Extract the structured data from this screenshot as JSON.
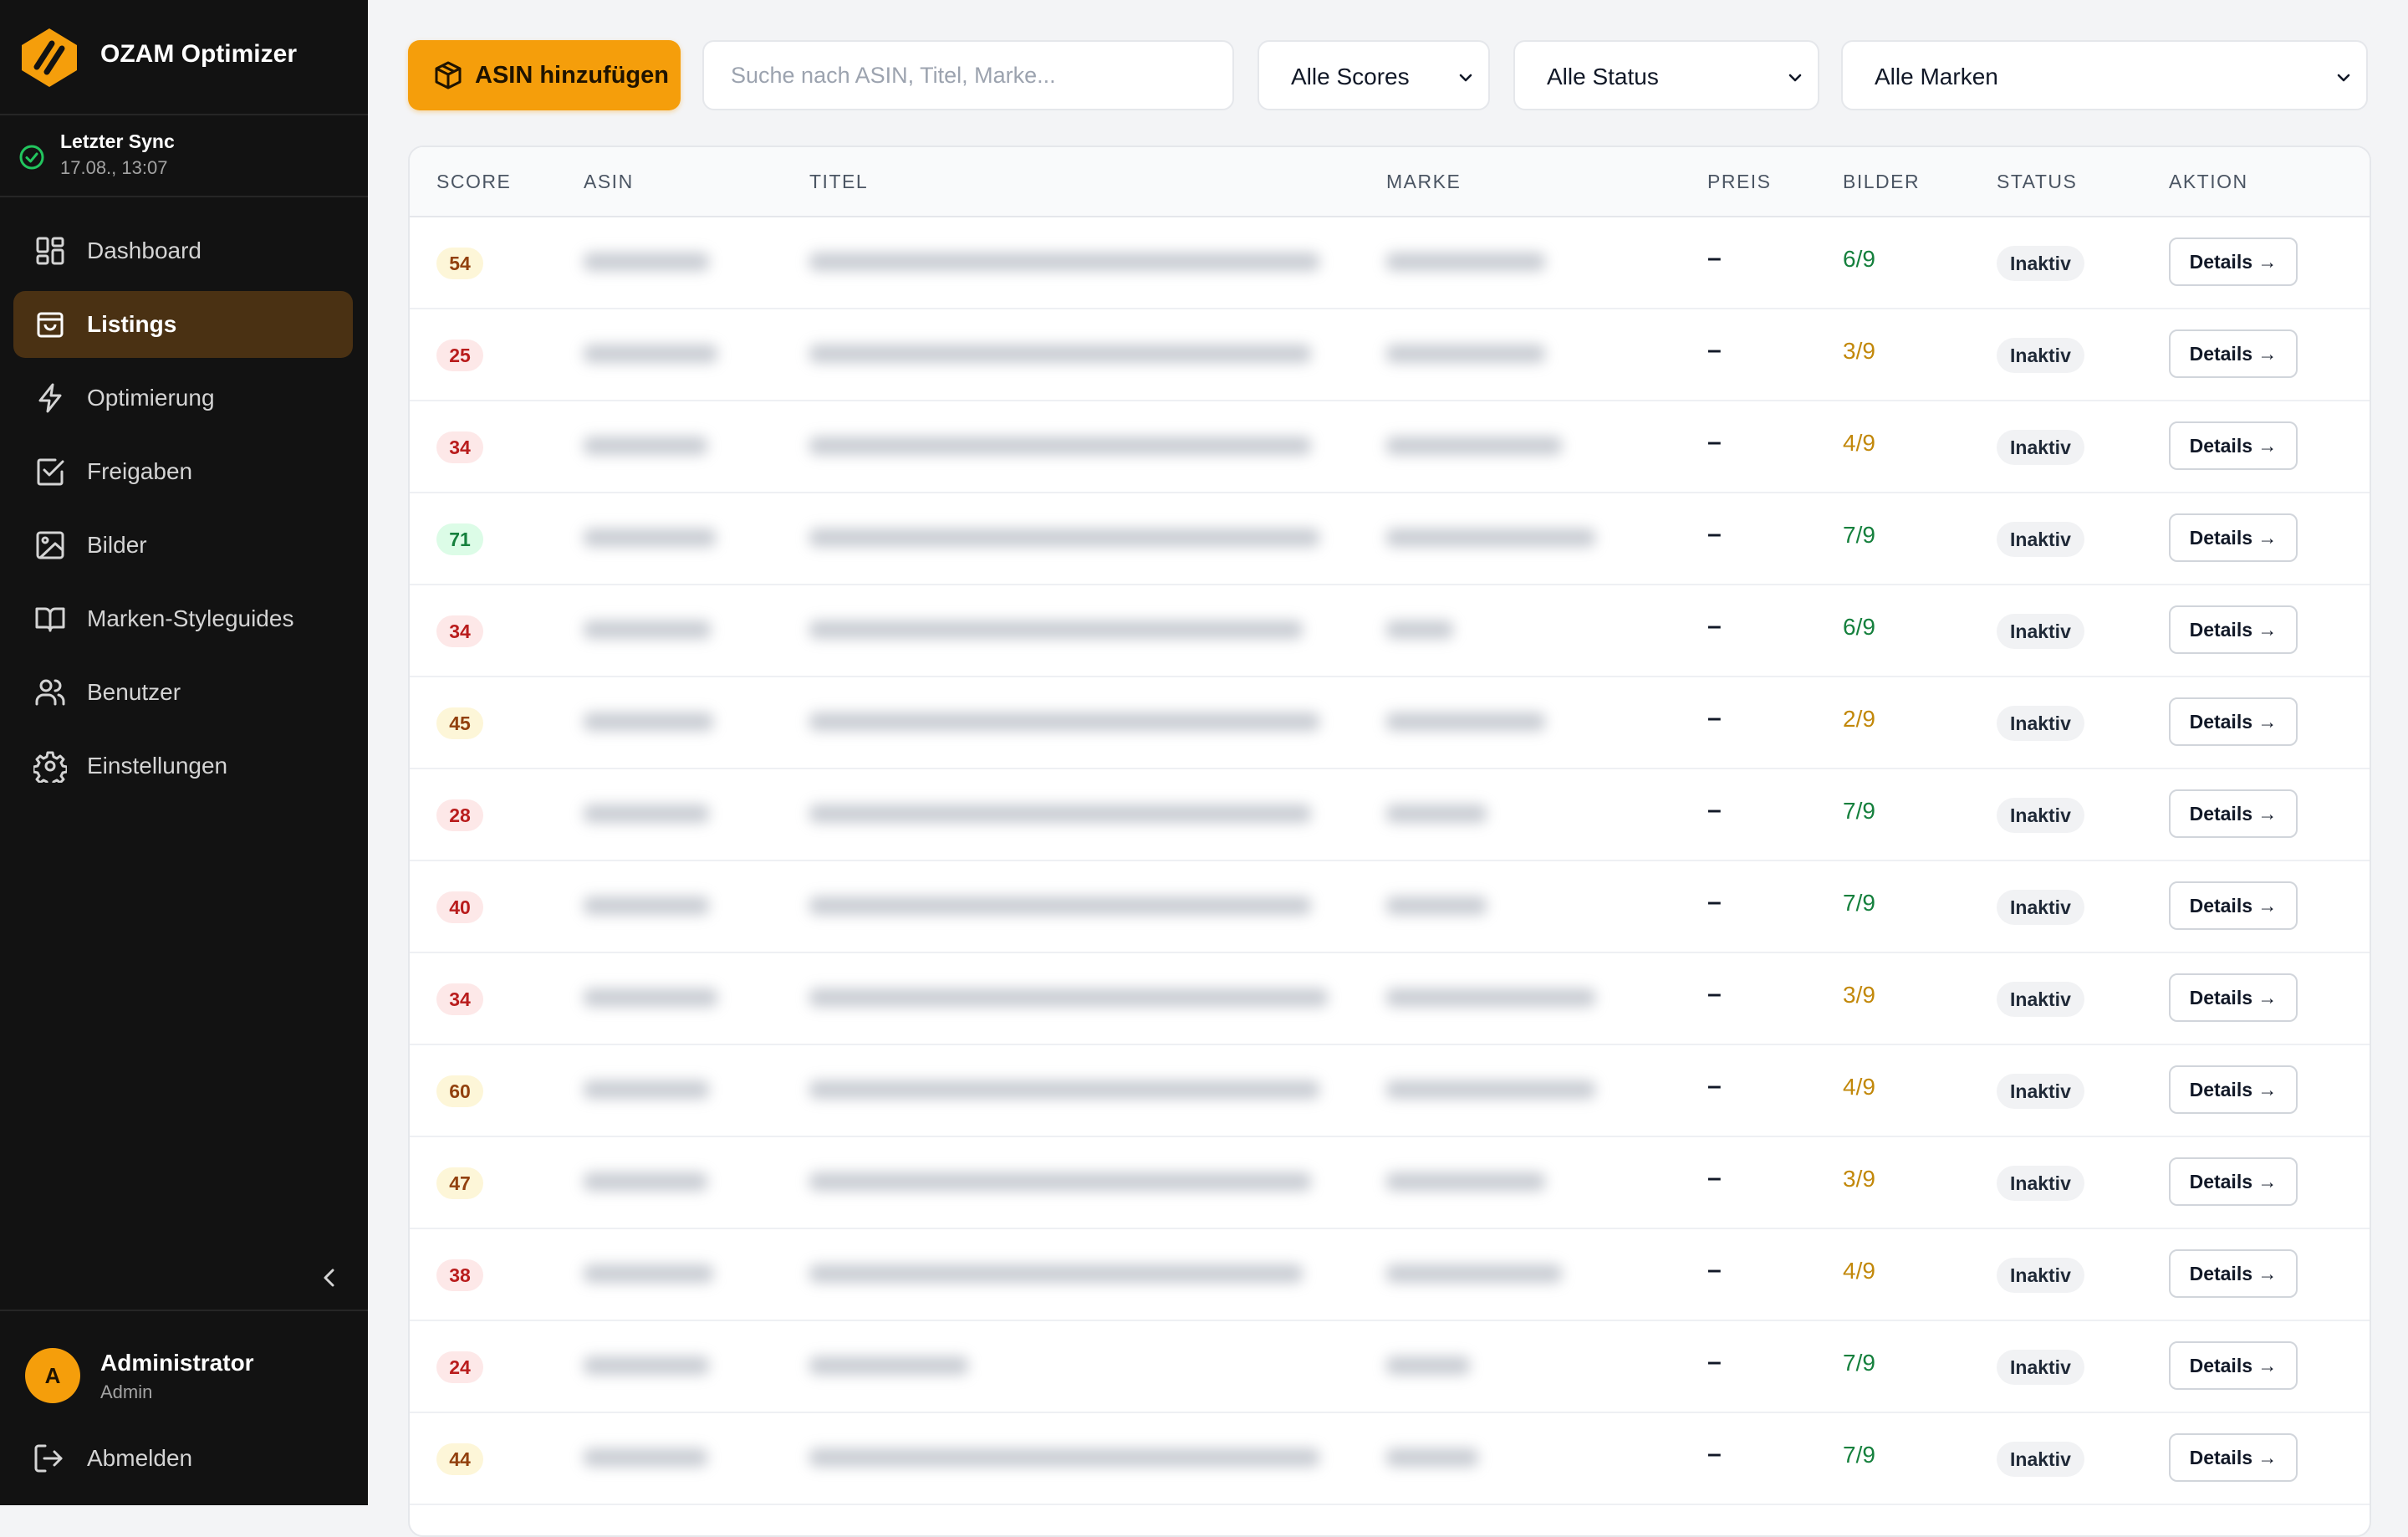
{
  "app": {
    "name": "OZAM Optimizer"
  },
  "sync": {
    "label": "Letzter Sync",
    "value": "17.08., 13:07"
  },
  "nav": [
    {
      "label": "Dashboard",
      "icon": "grid-icon",
      "active": false
    },
    {
      "label": "Listings",
      "icon": "shopping-bag-icon",
      "active": true
    },
    {
      "label": "Optimierung",
      "icon": "lightning-icon",
      "active": false
    },
    {
      "label": "Freigaben",
      "icon": "check-square-icon",
      "active": false
    },
    {
      "label": "Bilder",
      "icon": "image-icon",
      "active": false
    },
    {
      "label": "Marken-Styleguides",
      "icon": "book-icon",
      "active": false
    },
    {
      "label": "Benutzer",
      "icon": "users-icon",
      "active": false
    },
    {
      "label": "Einstellungen",
      "icon": "gear-icon",
      "active": false
    }
  ],
  "user": {
    "initial": "A",
    "name": "Administrator",
    "role": "Admin",
    "logout_label": "Abmelden"
  },
  "toolbar": {
    "add_label": "ASIN hinzufügen",
    "search_placeholder": "Suche nach ASIN, Titel, Marke...",
    "filter_scores": "Alle Scores",
    "filter_status": "Alle Status",
    "filter_brands": "Alle Marken"
  },
  "table": {
    "columns": [
      "SCORE",
      "ASIN",
      "TITEL",
      "MARKE",
      "PREIS",
      "BILDER",
      "STATUS",
      "AKTION"
    ],
    "action_label": "Details →",
    "rows": [
      {
        "score": "54",
        "level": "yellow",
        "preis": "–",
        "bilder": "6/9",
        "bilder_state": "good",
        "status": "Inaktiv"
      },
      {
        "score": "25",
        "level": "red",
        "preis": "–",
        "bilder": "3/9",
        "bilder_state": "warn",
        "status": "Inaktiv"
      },
      {
        "score": "34",
        "level": "red",
        "preis": "–",
        "bilder": "4/9",
        "bilder_state": "warn",
        "status": "Inaktiv"
      },
      {
        "score": "71",
        "level": "green",
        "preis": "–",
        "bilder": "7/9",
        "bilder_state": "good",
        "status": "Inaktiv"
      },
      {
        "score": "34",
        "level": "red",
        "preis": "–",
        "bilder": "6/9",
        "bilder_state": "good",
        "status": "Inaktiv"
      },
      {
        "score": "45",
        "level": "yellow",
        "preis": "–",
        "bilder": "2/9",
        "bilder_state": "warn",
        "status": "Inaktiv"
      },
      {
        "score": "28",
        "level": "red",
        "preis": "–",
        "bilder": "7/9",
        "bilder_state": "good",
        "status": "Inaktiv"
      },
      {
        "score": "40",
        "level": "red",
        "preis": "–",
        "bilder": "7/9",
        "bilder_state": "good",
        "status": "Inaktiv"
      },
      {
        "score": "34",
        "level": "red",
        "preis": "–",
        "bilder": "3/9",
        "bilder_state": "warn",
        "status": "Inaktiv"
      },
      {
        "score": "60",
        "level": "yellow",
        "preis": "–",
        "bilder": "4/9",
        "bilder_state": "warn",
        "status": "Inaktiv"
      },
      {
        "score": "47",
        "level": "yellow",
        "preis": "–",
        "bilder": "3/9",
        "bilder_state": "warn",
        "status": "Inaktiv"
      },
      {
        "score": "38",
        "level": "red",
        "preis": "–",
        "bilder": "4/9",
        "bilder_state": "warn",
        "status": "Inaktiv"
      },
      {
        "score": "24",
        "level": "red",
        "preis": "–",
        "bilder": "7/9",
        "bilder_state": "good",
        "status": "Inaktiv"
      },
      {
        "score": "44",
        "level": "yellow",
        "preis": "–",
        "bilder": "7/9",
        "bilder_state": "good",
        "status": "Inaktiv"
      }
    ]
  },
  "colors": {
    "accent": "#f59e0b",
    "sidebar": "#121212",
    "active_nav": "#4a3113",
    "good": "#15803d",
    "warn": "#c2880a"
  }
}
